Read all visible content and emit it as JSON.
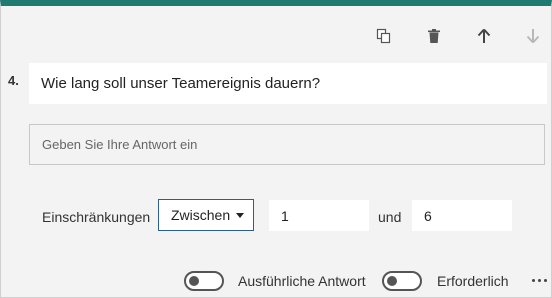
{
  "toolbar": {
    "copy_icon": "copy-icon",
    "delete_icon": "trash-icon",
    "move_up_icon": "arrow-up-icon",
    "move_down_icon": "arrow-down-icon"
  },
  "question": {
    "number": "4.",
    "text": "Wie lang soll unser Teamereignis dauern?"
  },
  "answer": {
    "placeholder": "Geben Sie Ihre Antwort ein"
  },
  "restrictions": {
    "label": "Einschränkungen",
    "type_selected": "Zwischen",
    "min_value": "1",
    "connector": "und",
    "max_value": "6"
  },
  "footer": {
    "long_answer_label": "Ausführliche Antwort",
    "long_answer_on": false,
    "required_label": "Erforderlich",
    "required_on": false,
    "more_icon": "more-horizontal-icon"
  },
  "colors": {
    "accent": "#1f7a72",
    "dropdown_border": "#2a5d94",
    "card_background": "#f3f3f3"
  }
}
